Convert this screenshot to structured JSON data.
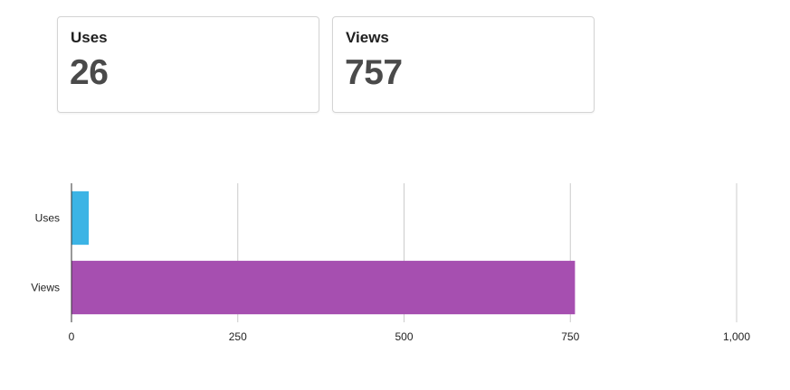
{
  "stats": [
    {
      "label": "Uses",
      "value": "26"
    },
    {
      "label": "Views",
      "value": "757"
    }
  ],
  "chart_data": {
    "type": "bar",
    "orientation": "horizontal",
    "categories": [
      "Uses",
      "Views"
    ],
    "values": [
      26,
      757
    ],
    "colors": [
      "#3cb4e5",
      "#a64fb0"
    ],
    "xlim": [
      0,
      1000
    ],
    "xticks": [
      0,
      250,
      500,
      750,
      1000
    ],
    "xtick_labels": [
      "0",
      "250",
      "500",
      "750",
      "1,000"
    ],
    "grid": true,
    "legend": "none",
    "title": "",
    "xlabel": "",
    "ylabel": ""
  }
}
